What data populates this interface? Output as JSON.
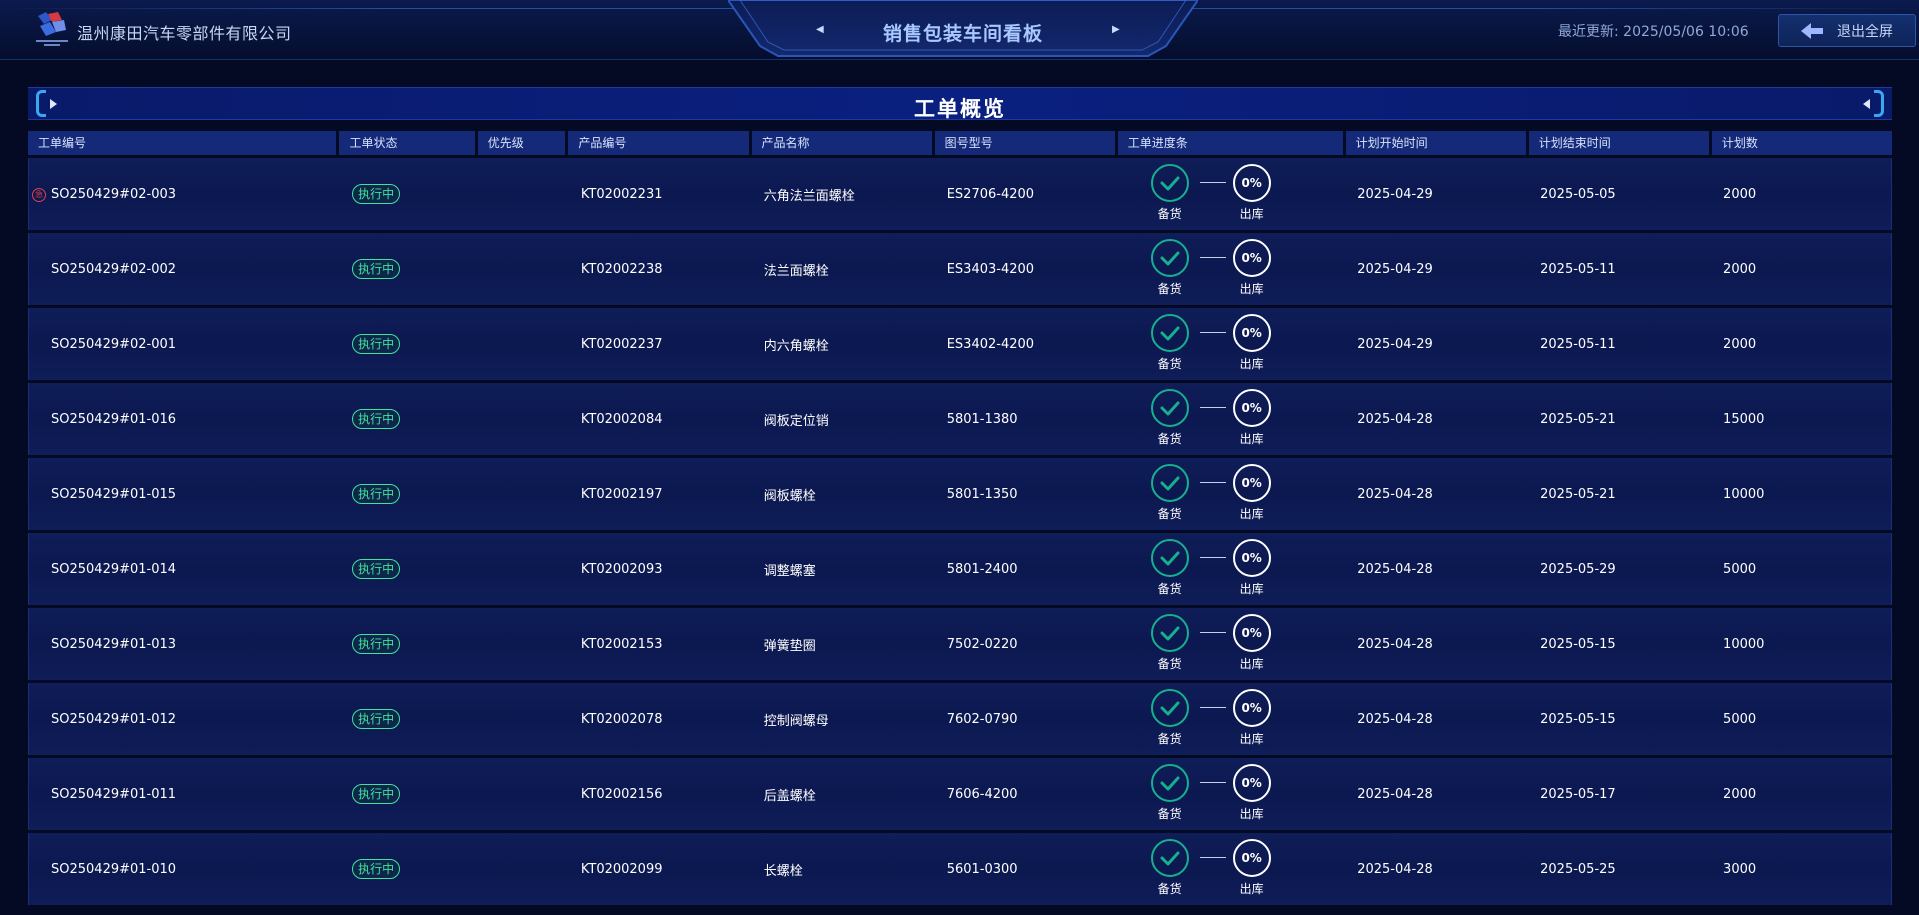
{
  "header": {
    "company": "温州康田汽车零部件有限公司",
    "title": "销售包装车间看板",
    "prev_arrow": "◀",
    "next_arrow": "▶",
    "updated": "最近更新: 2025/05/06 10:06",
    "exit_label": "退出全屏"
  },
  "panel": {
    "title": "工单概览"
  },
  "table": {
    "columns": [
      "工单编号",
      "工单状态",
      "优先级",
      "产品编号",
      "产品名称",
      "图号型号",
      "工单进度条",
      "计划开始时间",
      "计划结束时间",
      "计划数"
    ],
    "step_labels": [
      "备货",
      "出库"
    ],
    "rows": [
      {
        "order": "SO250429#02-003",
        "urgent": true,
        "urgent_mark": "急",
        "status": "执行中",
        "priority": "",
        "product_code": "KT02002231",
        "product_name": "六角法兰面螺栓",
        "drawing": "ES2706-4200",
        "progress": "0%",
        "start": "2025-04-29",
        "end": "2025-05-05",
        "qty": "2000"
      },
      {
        "order": "SO250429#02-002",
        "urgent": false,
        "status": "执行中",
        "priority": "",
        "product_code": "KT02002238",
        "product_name": "法兰面螺栓",
        "drawing": "ES3403-4200",
        "progress": "0%",
        "start": "2025-04-29",
        "end": "2025-05-11",
        "qty": "2000"
      },
      {
        "order": "SO250429#02-001",
        "urgent": false,
        "status": "执行中",
        "priority": "",
        "product_code": "KT02002237",
        "product_name": "内六角螺栓",
        "drawing": "ES3402-4200",
        "progress": "0%",
        "start": "2025-04-29",
        "end": "2025-05-11",
        "qty": "2000"
      },
      {
        "order": "SO250429#01-016",
        "urgent": false,
        "status": "执行中",
        "priority": "",
        "product_code": "KT02002084",
        "product_name": "阀板定位销",
        "drawing": "5801-1380",
        "progress": "0%",
        "start": "2025-04-28",
        "end": "2025-05-21",
        "qty": "15000"
      },
      {
        "order": "SO250429#01-015",
        "urgent": false,
        "status": "执行中",
        "priority": "",
        "product_code": "KT02002197",
        "product_name": "阀板螺栓",
        "drawing": "5801-1350",
        "progress": "0%",
        "start": "2025-04-28",
        "end": "2025-05-21",
        "qty": "10000"
      },
      {
        "order": "SO250429#01-014",
        "urgent": false,
        "status": "执行中",
        "priority": "",
        "product_code": "KT02002093",
        "product_name": "调整螺塞",
        "drawing": "5801-2400",
        "progress": "0%",
        "start": "2025-04-28",
        "end": "2025-05-29",
        "qty": "5000"
      },
      {
        "order": "SO250429#01-013",
        "urgent": false,
        "status": "执行中",
        "priority": "",
        "product_code": "KT02002153",
        "product_name": "弹簧垫圈",
        "drawing": "7502-0220",
        "progress": "0%",
        "start": "2025-04-28",
        "end": "2025-05-15",
        "qty": "10000"
      },
      {
        "order": "SO250429#01-012",
        "urgent": false,
        "status": "执行中",
        "priority": "",
        "product_code": "KT02002078",
        "product_name": "控制阀螺母",
        "drawing": "7602-0790",
        "progress": "0%",
        "start": "2025-04-28",
        "end": "2025-05-15",
        "qty": "5000"
      },
      {
        "order": "SO250429#01-011",
        "urgent": false,
        "status": "执行中",
        "priority": "",
        "product_code": "KT02002156",
        "product_name": "后盖螺栓",
        "drawing": "7606-4200",
        "progress": "0%",
        "start": "2025-04-28",
        "end": "2025-05-17",
        "qty": "2000"
      },
      {
        "order": "SO250429#01-010",
        "urgent": false,
        "status": "执行中",
        "priority": "",
        "product_code": "KT02002099",
        "product_name": "长螺栓",
        "drawing": "5601-0300",
        "progress": "0%",
        "start": "2025-04-28",
        "end": "2025-05-25",
        "qty": "3000"
      }
    ]
  },
  "colors": {
    "background": "#040a24",
    "accent": "#3aa8f0",
    "status_green": "#3fe39b",
    "step_done": "#16b08e",
    "urgent_red": "#e0424a"
  }
}
